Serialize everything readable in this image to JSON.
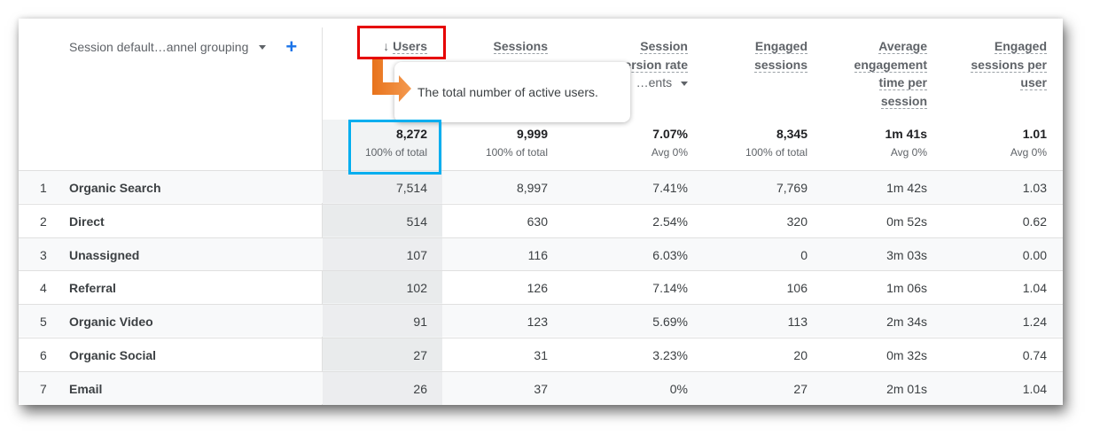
{
  "dimension": {
    "label": "Session default…annel grouping",
    "dropdown_icon": "caret-down-icon",
    "add_icon": "plus-icon"
  },
  "columns": [
    {
      "lines": [
        "Users"
      ],
      "sort_icon": "arrow-down-icon",
      "total": "8,272",
      "total_sub": "100% of total"
    },
    {
      "lines": [
        "Sessions"
      ],
      "total": "9,999",
      "total_sub": "100% of total"
    },
    {
      "lines": [
        "Session",
        "conversion rate"
      ],
      "sub": "…ents",
      "total": "7.07%",
      "total_sub": "Avg 0%"
    },
    {
      "lines": [
        "Engaged",
        "sessions"
      ],
      "total": "8,345",
      "total_sub": "100% of total"
    },
    {
      "lines": [
        "Average",
        "engagement",
        "time per",
        "session"
      ],
      "total": "1m 41s",
      "total_sub": "Avg 0%"
    },
    {
      "lines": [
        "Engaged",
        "sessions per",
        "user"
      ],
      "total": "1.01",
      "total_sub": "Avg 0%"
    }
  ],
  "tooltip": {
    "text": "The total number of active users."
  },
  "rows": [
    {
      "idx": "1",
      "name": "Organic Search",
      "values": [
        "7,514",
        "8,997",
        "7.41%",
        "7,769",
        "1m 42s",
        "1.03"
      ]
    },
    {
      "idx": "2",
      "name": "Direct",
      "values": [
        "514",
        "630",
        "2.54%",
        "320",
        "0m 52s",
        "0.62"
      ]
    },
    {
      "idx": "3",
      "name": "Unassigned",
      "values": [
        "107",
        "116",
        "6.03%",
        "0",
        "3m 03s",
        "0.00"
      ]
    },
    {
      "idx": "4",
      "name": "Referral",
      "values": [
        "102",
        "126",
        "7.14%",
        "106",
        "1m 06s",
        "1.04"
      ]
    },
    {
      "idx": "5",
      "name": "Organic Video",
      "values": [
        "91",
        "123",
        "5.69%",
        "113",
        "2m 34s",
        "1.24"
      ]
    },
    {
      "idx": "6",
      "name": "Organic Social",
      "values": [
        "27",
        "31",
        "3.23%",
        "20",
        "0m 32s",
        "0.74"
      ]
    },
    {
      "idx": "7",
      "name": "Email",
      "values": [
        "26",
        "37",
        "0%",
        "27",
        "2m 01s",
        "1.04"
      ]
    }
  ],
  "annotations": {
    "red_box": "#e60000",
    "blue_box": "#00aeef",
    "arrow": "#f07b24"
  }
}
